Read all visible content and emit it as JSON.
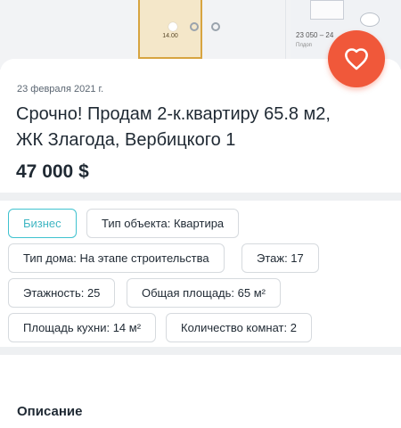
{
  "gallery": {
    "plan_number": "14.00",
    "plan2_dimension": "23 050 – 24",
    "plan2_small_text": "Плдоп",
    "dots": 3,
    "active_dot": 0
  },
  "listing": {
    "date": "23 февраля 2021 г.",
    "title": "Срочно! Продам 2-к.квартиру 65.8 м2, ЖК Злагода, Вербицкого 1",
    "price": "47 000 $",
    "favorite_icon": "heart-icon"
  },
  "chips": [
    "Бизнес",
    "Тип объекта: Квартира",
    "Тип дома: На этапе строительства",
    "Этаж: 17",
    "Этажность: 25",
    "Общая площадь: 65 м²",
    "Площадь кухни: 14 м²",
    "Количество комнат: 2"
  ],
  "description": {
    "title": "Описание"
  },
  "colors": {
    "accent": "#f0583a",
    "chip_highlight": "#3fc2cf",
    "separator": "#eef0f2"
  }
}
